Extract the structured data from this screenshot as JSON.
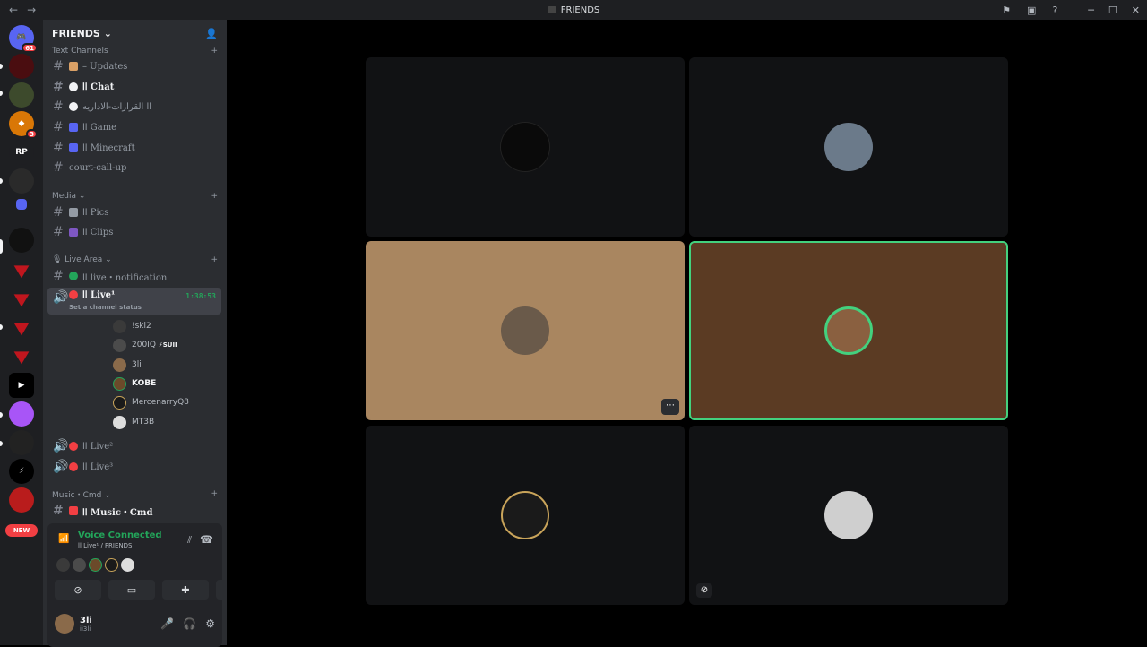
{
  "window": {
    "title": "FRIENDS",
    "back_icon": "←",
    "forward_icon": "→",
    "min_icon": "─",
    "max_icon": "☐",
    "close_icon": "✕"
  },
  "guilds": {
    "dm_badge": "61",
    "rp_label": "RP",
    "badge_3": "3",
    "new_label": "NEW"
  },
  "server": {
    "name": "FRIENDS"
  },
  "categories": {
    "text": "Text Channels",
    "media": "Media",
    "live": "Live Area",
    "music": "Music・Cmd"
  },
  "channels": {
    "updates": "– Updates",
    "chat": "اا Chat",
    "arabic": "اا القرارات-الاداريه",
    "game": "اا Game",
    "minecraft": "اا Minecraft",
    "court": "court-call-up",
    "pics": "اا Pics",
    "clips": "اا Clips",
    "live_notification": "اا live・notification",
    "live1": "اا Live¹",
    "live1_time": "1:38:53",
    "live1_status": "Set a channel status",
    "live2": "اا Live²",
    "live3": "اا Live³",
    "music_cmd": "اا Music・Cmd"
  },
  "voice_users": [
    {
      "name": "!skl2"
    },
    {
      "name": "200IQ",
      "extra": "⚡SUII"
    },
    {
      "name": "3li"
    },
    {
      "name": "KOBE"
    },
    {
      "name": "MercenarryQ8"
    },
    {
      "name": "MT3B"
    }
  ],
  "voice_panel": {
    "status": "Voice Connected",
    "sub": "اا Live¹ / FRIENDS"
  },
  "user": {
    "name": "3li",
    "tag": "ii3li"
  },
  "colors": {
    "accent_green": "#23a55a",
    "speaking": "#43d17e",
    "tan_tile": "#a98660",
    "brown_tile": "#5b3b23"
  }
}
